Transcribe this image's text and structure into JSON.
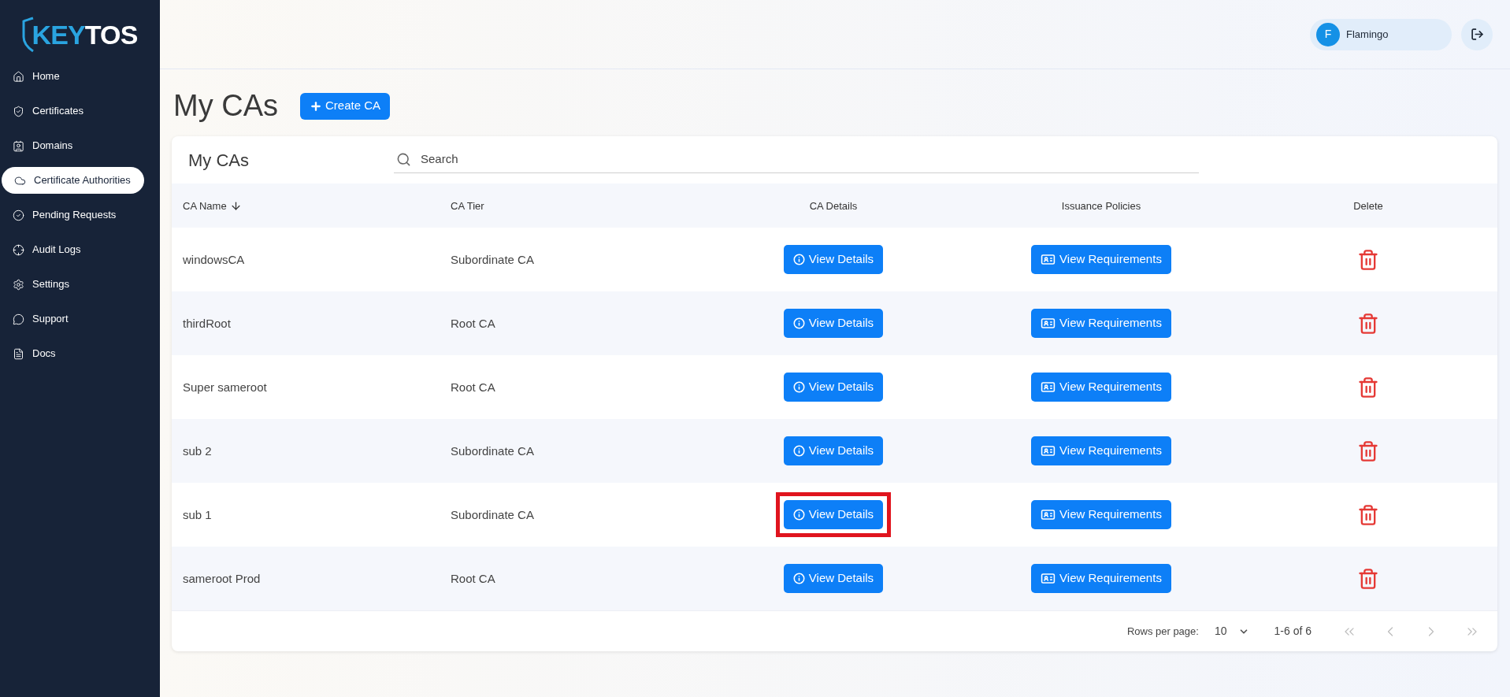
{
  "sidebar": {
    "logo": {
      "part_1": "KEY",
      "part_2": "TOS"
    },
    "items": [
      {
        "label": "Home",
        "selected": false
      },
      {
        "label": "Certificates",
        "selected": false
      },
      {
        "label": "Domains",
        "selected": false
      },
      {
        "label": "Certificate Authorities",
        "selected": true
      },
      {
        "label": "Pending Requests",
        "selected": false
      },
      {
        "label": "Audit Logs",
        "selected": false
      },
      {
        "label": "Settings",
        "selected": false
      },
      {
        "label": "Support",
        "selected": false
      },
      {
        "label": "Docs",
        "selected": false
      }
    ]
  },
  "header": {
    "user": {
      "initial": "F",
      "name": "Flamingo"
    }
  },
  "page": {
    "title": "My CAs",
    "create_button": "Create CA"
  },
  "table": {
    "title": "My CAs",
    "search": {
      "placeholder": "Search"
    },
    "columns": [
      {
        "label": "CA Name",
        "sorted": true
      },
      {
        "label": "CA Tier",
        "sorted": false
      },
      {
        "label": "CA Details",
        "sorted": false
      },
      {
        "label": "Issuance Policies",
        "sorted": false
      },
      {
        "label": "Delete",
        "sorted": false
      }
    ],
    "rows": [
      {
        "name": "windowsCA",
        "tier": "Subordinate CA",
        "details": "View Details",
        "policies": "View Requirements",
        "highlighted": false
      },
      {
        "name": "thirdRoot",
        "tier": "Root CA",
        "details": "View Details",
        "policies": "View Requirements",
        "highlighted": false
      },
      {
        "name": "Super sameroot",
        "tier": "Root CA",
        "details": "View Details",
        "policies": "View Requirements",
        "highlighted": false
      },
      {
        "name": "sub 2",
        "tier": "Subordinate CA",
        "details": "View Details",
        "policies": "View Requirements",
        "highlighted": false
      },
      {
        "name": "sub 1",
        "tier": "Subordinate CA",
        "details": "View Details",
        "policies": "View Requirements",
        "highlighted": true
      },
      {
        "name": "sameroot Prod",
        "tier": "Root CA",
        "details": "View Details",
        "policies": "View Requirements",
        "highlighted": false
      }
    ],
    "pagination": {
      "rows_label": "Rows per page:",
      "rows_value": "10",
      "range": "1-6 of 6",
      "buttons": [
        {
          "kind": "first",
          "disabled": true
        },
        {
          "kind": "prev",
          "disabled": true
        },
        {
          "kind": "next",
          "disabled": true
        },
        {
          "kind": "last",
          "disabled": true
        }
      ]
    }
  }
}
